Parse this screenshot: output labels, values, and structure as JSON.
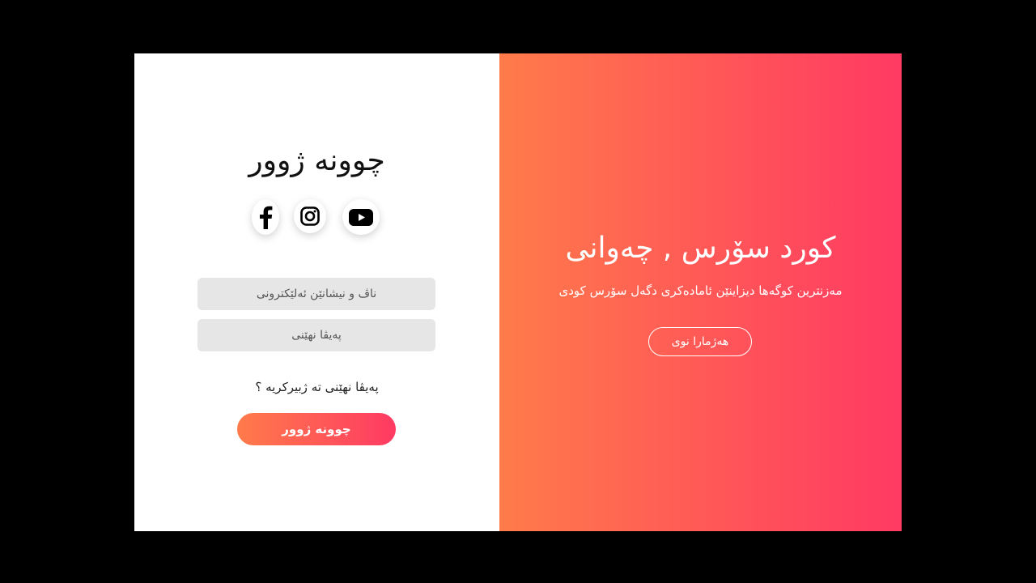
{
  "login": {
    "title": "چوونە ژوور",
    "social": [
      {
        "icon": "facebook-icon"
      },
      {
        "icon": "instagram-icon"
      },
      {
        "icon": "youtube-icon"
      }
    ],
    "email_placeholder": "ناڤ و نیشانێن ئەلێکترونی",
    "password_placeholder": "پەیڤا نهێنی",
    "forgot_label": "پەیڤا نهێنی تە ژبیرکریە ؟",
    "submit_label": "چوونە ژوور"
  },
  "welcome": {
    "title": "کورد سۆرس , چەوانی",
    "subtitle": "مەزنترین کوگەها دیزاینێن ئامادەکری دگەل سۆرس کودی",
    "signup_label": "هەژمارا نوی"
  },
  "colors": {
    "gradient_start": "#ff7b4a",
    "gradient_end": "#ff3a63",
    "field_bg": "#e6e6e6",
    "page_bg": "#000000"
  }
}
